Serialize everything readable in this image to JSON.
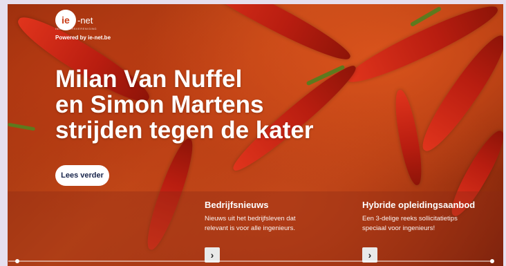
{
  "brand": {
    "logo_mark": "ie",
    "logo_word": "-net",
    "logo_tagline": "INGENIEURSVERENIGING",
    "powered_by": "Powered by ie-net.be"
  },
  "hero": {
    "headline_line1": "Milan Van Nuffel",
    "headline_line2": "en Simon Martens",
    "headline_line3": "strijden tegen de kater",
    "cta_label": "Lees verder",
    "background_theme": "red-chili-peppers-with-spice-powder"
  },
  "cards": [
    {
      "title": "Bedrijfsnieuws",
      "text_line1": "Nieuws uit het bedrijfsleven dat",
      "text_line2": "relevant is voor alle ingenieurs.",
      "arrow_icon": "chevron-right-icon"
    },
    {
      "title": "Hybride opleidingsaanbod",
      "text_line1": "Een 3-delige reeks sollicitatietips",
      "text_line2": "speciaal voor ingenieurs!",
      "arrow_icon": "chevron-right-icon"
    }
  ],
  "colors": {
    "button_text": "#17244b",
    "brand_orange": "#c93b16",
    "text_light": "#ffffff"
  }
}
